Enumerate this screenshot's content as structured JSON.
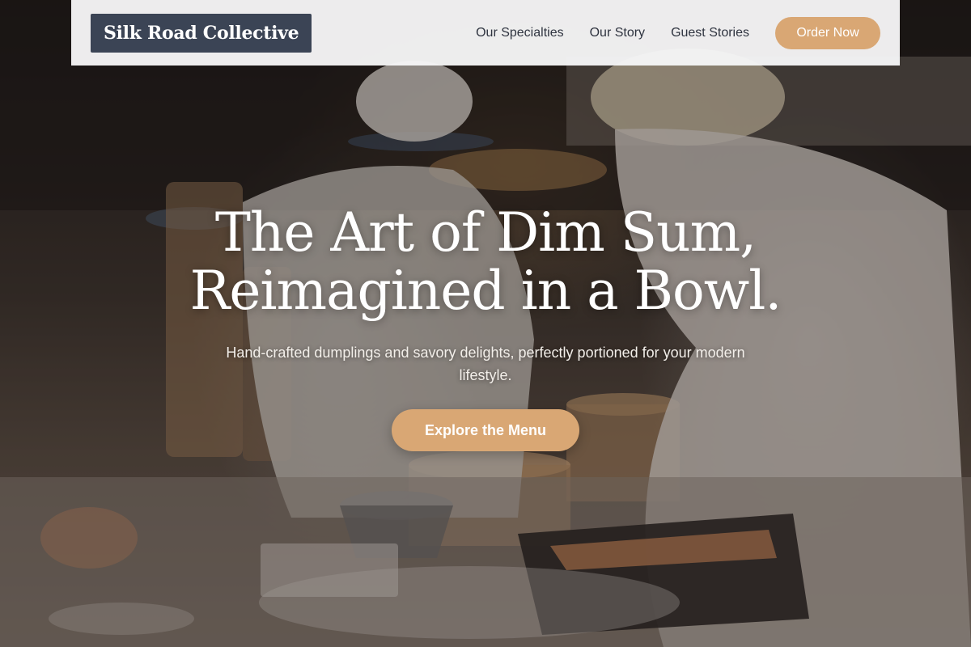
{
  "nav": {
    "brand": "Silk Road Collective",
    "links": [
      "Our Specialties",
      "Our Story",
      "Guest Stories"
    ],
    "order_label": "Order Now"
  },
  "hero": {
    "title_line1": "The Art of Dim Sum,",
    "title_line2": "Reimagined in a Bowl.",
    "subtitle": "Hand-crafted dumplings and savory delights, perfectly portioned for your modern lifestyle.",
    "cta_label": "Explore the Menu",
    "background_image": "chefs-preparing-dim-sum-kitchen"
  },
  "colors": {
    "brand_bg": "#3b4455",
    "accent": "#d9a774",
    "nav_bg": "#f6f6f7",
    "nav_text": "#2f3440"
  }
}
